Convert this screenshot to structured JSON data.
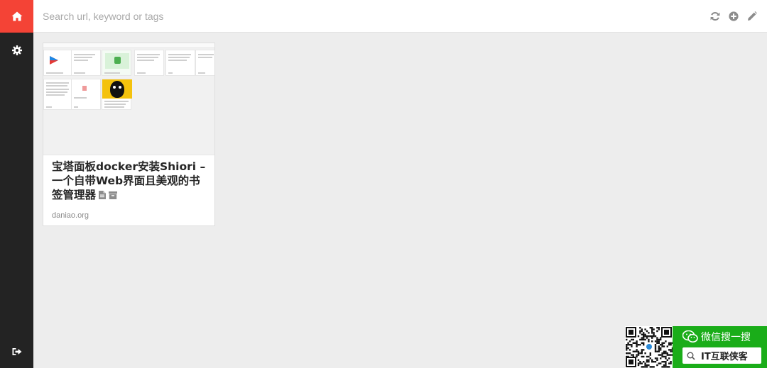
{
  "sidebar": {
    "items": [
      {
        "name": "home",
        "icon": "home-icon"
      },
      {
        "name": "settings",
        "icon": "gear-icon"
      }
    ],
    "bottom": {
      "name": "logout",
      "icon": "sign-out-icon"
    },
    "accent": "#f44336",
    "background": "#232323"
  },
  "search": {
    "placeholder": "Search url, keyword or tags",
    "value": ""
  },
  "top_actions": [
    {
      "name": "refresh",
      "icon": "refresh-icon"
    },
    {
      "name": "add-bookmark",
      "icon": "plus-circle-icon"
    },
    {
      "name": "edit-mode",
      "icon": "pencil-icon"
    }
  ],
  "bookmarks": [
    {
      "title": "宝塔面板docker安装Shiori – 一个自带Web界面且美观的书签管理器",
      "url": "daniao.org",
      "icons": [
        "file-text-icon",
        "archive-icon"
      ]
    }
  ],
  "widget": {
    "wechat_label": "微信搜一搜",
    "search_term": "IT互联侠客",
    "color": "#1aad19"
  }
}
